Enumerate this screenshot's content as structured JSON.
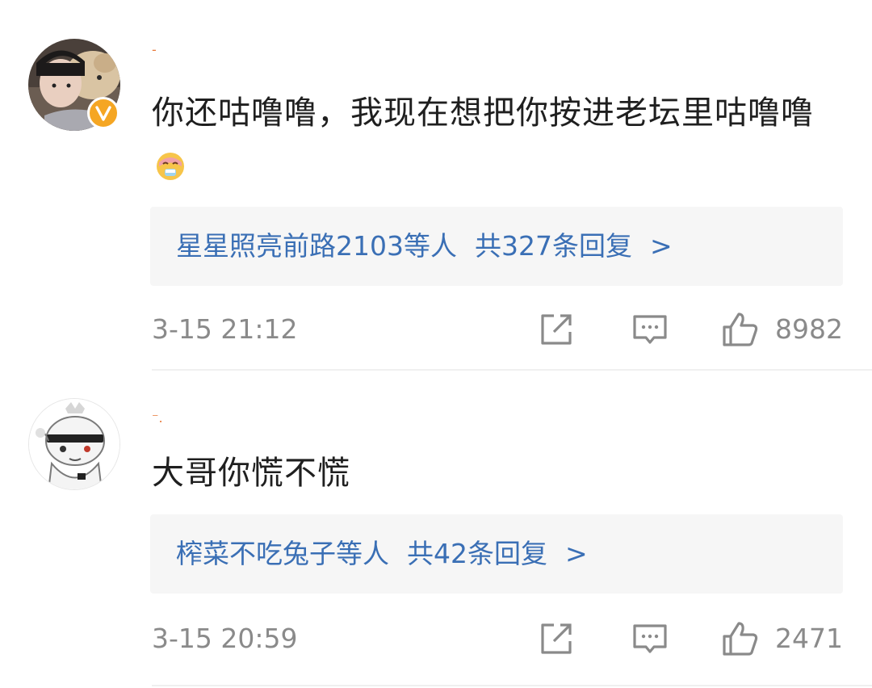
{
  "comments": [
    {
      "username": "-",
      "text": "你还咕噜噜，我现在想把你按进老坛里咕噜噜",
      "emoji": "drooling-face-emoji",
      "replies": {
        "names": "星星照亮前路2103等人",
        "count": "共327条回复",
        "arrow": ">"
      },
      "timestamp": "3-15 21:12",
      "likes": "8982",
      "verified": true
    },
    {
      "username": "⁻.",
      "text": "大哥你慌不慌",
      "replies": {
        "names": "榨菜不吃兔子等人",
        "count": "共42条回复",
        "arrow": ">"
      },
      "timestamp": "3-15 20:59",
      "likes": "2471",
      "verified": false
    }
  ],
  "colors": {
    "link": "#3a6fb5",
    "meta": "#8a8a8a",
    "text": "#1f1f1f",
    "reply_bg": "#f6f6f6",
    "badge": "#f5a623"
  },
  "icons": [
    "share-icon",
    "comment-icon",
    "thumbs-up-icon",
    "verified-badge-icon"
  ]
}
